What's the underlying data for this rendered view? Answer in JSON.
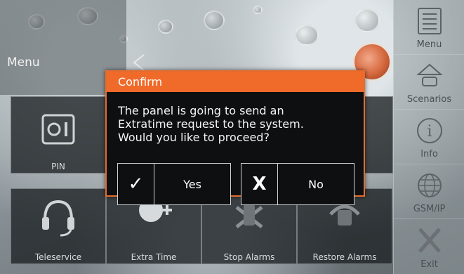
{
  "header": {
    "title": "Menu"
  },
  "tiles": [
    {
      "label": "PIN",
      "icon": "safe-icon"
    },
    {
      "label": "Teleservice",
      "icon": "headset-icon"
    },
    {
      "label": "Extra Time",
      "icon": "clock-plus-icon"
    },
    {
      "label": "Stop Alarms",
      "icon": "stop-alarm-icon"
    },
    {
      "label": "Restore Alarms",
      "icon": "restore-alarm-icon"
    }
  ],
  "sidebar": {
    "items": [
      {
        "label": "Menu",
        "icon": "menu-list-icon"
      },
      {
        "label": "Scenarios",
        "icon": "scenarios-icon"
      },
      {
        "label": "Info",
        "icon": "info-icon"
      },
      {
        "label": "GSM/IP",
        "icon": "globe-icon"
      },
      {
        "label": "Exit",
        "icon": "exit-x-icon"
      }
    ]
  },
  "dialog": {
    "title": "Confirm",
    "message": "The panel is going to send an\nExtratime request to the system.\nWould you like to proceed?",
    "yes": {
      "symbol": "✓",
      "label": "Yes"
    },
    "no": {
      "symbol": "X",
      "label": "No"
    }
  },
  "colors": {
    "accent": "#f06a2a",
    "dialog_bg": "#0e0f10",
    "tile_bg": "#1c2124"
  }
}
